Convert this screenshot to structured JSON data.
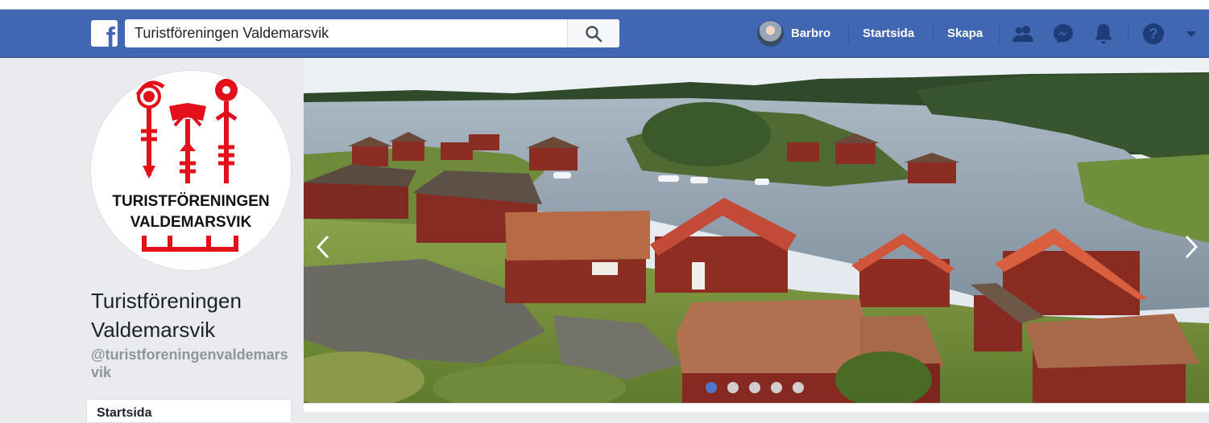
{
  "brand": {
    "logo_letter": "f",
    "color": "#4267b2"
  },
  "search": {
    "value": "Turistföreningen Valdemarsvik",
    "icon": "search-icon"
  },
  "nav": {
    "user_name": "Barbro",
    "home_label": "Startsida",
    "create_label": "Skapa",
    "icons": [
      "friends-icon",
      "messenger-icon",
      "notifications-icon",
      "help-icon",
      "caret-down-icon"
    ]
  },
  "page": {
    "logo_text_line1": "TURISTFÖRENINGEN",
    "logo_text_line2": "VALDEMARSVIK",
    "name": "Turistföreningen Valdemarsvik",
    "handle": "@turistforeningenvaldemarsvik",
    "menu_first_item": "Startsida"
  },
  "cover": {
    "slide_count": 5,
    "active_slide": 1,
    "prev_icon": "chevron-left-icon",
    "next_icon": "chevron-right-icon"
  }
}
